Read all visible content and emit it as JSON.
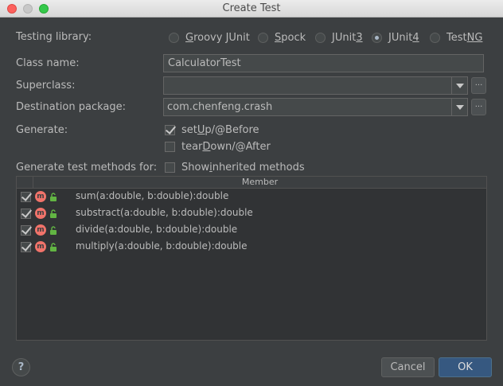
{
  "window": {
    "title": "Create Test"
  },
  "testing_library": {
    "label": "Testing library:",
    "options": [
      {
        "pre": "",
        "u": "G",
        "post": "roovy JUnit",
        "selected": false
      },
      {
        "pre": "",
        "u": "S",
        "post": "pock",
        "selected": false
      },
      {
        "pre": "JUnit",
        "u": "3",
        "post": "",
        "selected": false
      },
      {
        "pre": "JUnit",
        "u": "4",
        "post": "",
        "selected": true
      },
      {
        "pre": "Test",
        "u": "NG",
        "post": "",
        "selected": false
      }
    ]
  },
  "class_name": {
    "label": "Class name:",
    "value": "CalculatorTest"
  },
  "superclass": {
    "label": "Superclass:",
    "value": "",
    "button": "..."
  },
  "destination_package": {
    "label": "Destination package:",
    "value": "com.chenfeng.crash",
    "button": "..."
  },
  "generate": {
    "label": "Generate:",
    "setup": {
      "pre": "set",
      "u": "U",
      "post": "p/@Before",
      "checked": true
    },
    "teardown": {
      "pre": "tear",
      "u": "D",
      "post": "own/@After",
      "checked": false
    }
  },
  "methods": {
    "label": "Generate test methods for:",
    "show_inherited": {
      "pre": "Show ",
      "u": "i",
      "post": "nherited methods",
      "checked": false
    },
    "column_header": "Member",
    "icon_letter": "m",
    "rows": [
      {
        "text": "sum(a:double, b:double):double",
        "checked": true
      },
      {
        "text": "substract(a:double, b:double):double",
        "checked": true
      },
      {
        "text": "divide(a:double, b:double):double",
        "checked": true
      },
      {
        "text": "multiply(a:double, b:double):double",
        "checked": true
      }
    ]
  },
  "footer": {
    "help": "?",
    "cancel": "Cancel",
    "ok": "OK"
  }
}
